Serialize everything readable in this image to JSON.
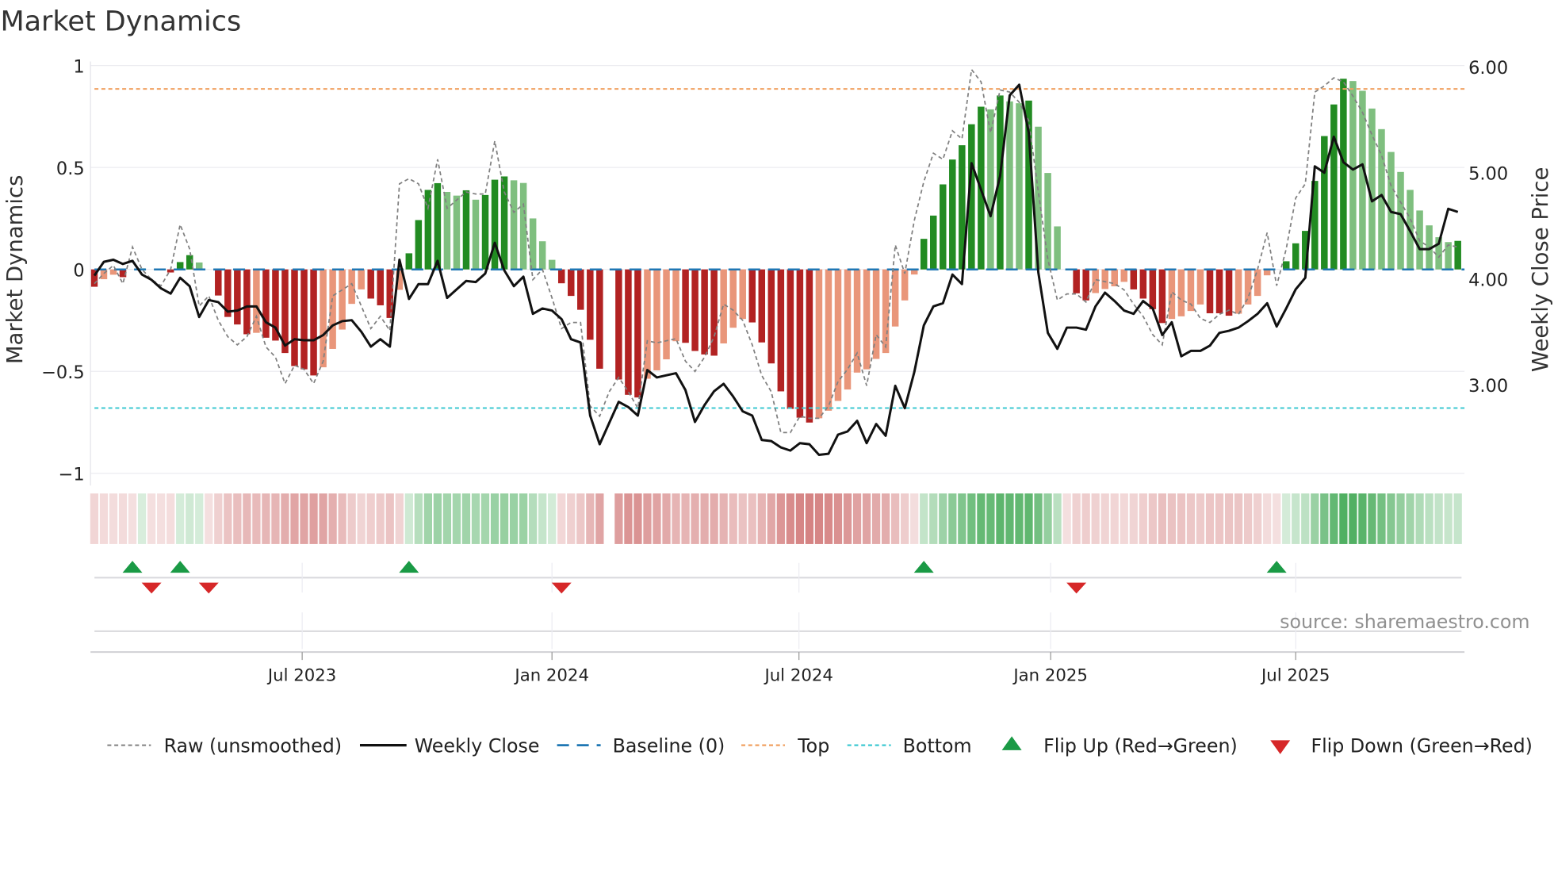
{
  "title": "Market Dynamics",
  "source": "source: sharemaestro.com",
  "colors": {
    "bar_up_strong": "#228b22",
    "bar_up_weak": "#7fbf7f",
    "bar_down_strong": "#b22222",
    "bar_down_weak": "#e9967a",
    "raw": "#808080",
    "close": "#111111",
    "baseline": "#1f77b4",
    "top": "#f0a060",
    "bottom": "#3cc8d2",
    "flip_up": "#1a9a45",
    "flip_down": "#d62728"
  },
  "legend": {
    "raw": "Raw (unsmoothed)",
    "close": "Weekly Close",
    "baseline": "Baseline (0)",
    "top": "Top",
    "bottom": "Bottom",
    "flip_up": "Flip Up (Red→Green)",
    "flip_down": "Flip Down (Green→Red)"
  },
  "chart_data": {
    "type": "bar",
    "title": "Market Dynamics",
    "ylabel": "Market Dynamics",
    "y2label": "Weekly Close Price",
    "x_unit": "week index",
    "xlim": [
      -0.4,
      143.7
    ],
    "ylim": [
      -1.06,
      1.02
    ],
    "y2lim": [
      2.05,
      6.05
    ],
    "y_ticks": [
      {
        "v": 1,
        "label": "1"
      },
      {
        "v": 0.5,
        "label": "0.5"
      },
      {
        "v": 0,
        "label": "0"
      },
      {
        "v": -0.5,
        "label": "−0.5"
      },
      {
        "v": -1,
        "label": "−1"
      }
    ],
    "y2_ticks": [
      {
        "v": 6,
        "label": "6.00"
      },
      {
        "v": 5,
        "label": "5.00"
      },
      {
        "v": 4,
        "label": "4.00"
      },
      {
        "v": 3,
        "label": "3.00"
      }
    ],
    "x_ticks": [
      {
        "v": 21.8,
        "label": "Jul 2023"
      },
      {
        "v": 48.0,
        "label": "Jan 2024"
      },
      {
        "v": 73.9,
        "label": "Jul 2024"
      },
      {
        "v": 100.3,
        "label": "Jan 2025"
      },
      {
        "v": 126.0,
        "label": "Jul 2025"
      }
    ],
    "top_level": 0.885,
    "bottom_level": -0.68,
    "baseline": 0,
    "dynamics": [
      -0.085,
      -0.048,
      -0.026,
      -0.038,
      0,
      0.005,
      0,
      0,
      -0.015,
      0.036,
      0.07,
      0.034,
      0,
      -0.128,
      -0.233,
      -0.27,
      -0.318,
      -0.311,
      -0.335,
      -0.349,
      -0.41,
      -0.474,
      -0.49,
      -0.52,
      -0.48,
      -0.39,
      -0.295,
      -0.169,
      -0.098,
      -0.143,
      -0.176,
      -0.238,
      -0.1,
      0.079,
      0.242,
      0.39,
      0.423,
      0.38,
      0.362,
      0.388,
      0.342,
      0.365,
      0.44,
      0.456,
      0.437,
      0.424,
      0.25,
      0.138,
      0.047,
      -0.068,
      -0.13,
      -0.198,
      -0.345,
      -0.487,
      null,
      -0.54,
      -0.615,
      -0.628,
      -0.536,
      -0.495,
      -0.441,
      -0.352,
      -0.36,
      -0.4,
      -0.417,
      -0.423,
      -0.363,
      -0.286,
      -0.243,
      -0.26,
      -0.358,
      -0.461,
      -0.598,
      -0.684,
      -0.727,
      -0.751,
      -0.73,
      -0.693,
      -0.645,
      -0.589,
      -0.506,
      -0.49,
      -0.439,
      -0.41,
      -0.28,
      -0.152,
      -0.025,
      0.15,
      0.264,
      0.417,
      0.539,
      0.609,
      0.712,
      0.798,
      0.785,
      0.853,
      0.824,
      0.815,
      0.828,
      0.7,
      0.473,
      0.211,
      0,
      -0.117,
      -0.152,
      -0.116,
      -0.096,
      -0.083,
      -0.061,
      -0.098,
      -0.143,
      -0.195,
      -0.263,
      -0.243,
      -0.23,
      -0.204,
      -0.172,
      -0.215,
      -0.215,
      -0.227,
      -0.217,
      -0.172,
      -0.13,
      -0.029,
      0,
      0.04,
      0.128,
      0.189,
      0.434,
      0.654,
      0.809,
      0.935,
      0.924,
      0.876,
      0.789,
      0.688,
      0.576,
      0.478,
      0.39,
      0.289,
      0.216,
      0.158,
      0.134,
      0.14
    ],
    "strong": [
      1,
      0,
      0,
      1,
      0,
      1,
      0,
      0,
      1,
      1,
      1,
      0,
      0,
      1,
      1,
      1,
      1,
      0,
      1,
      1,
      1,
      1,
      1,
      1,
      0,
      0,
      0,
      0,
      0,
      1,
      1,
      1,
      0,
      1,
      1,
      1,
      1,
      0,
      0,
      1,
      0,
      1,
      1,
      1,
      0,
      0,
      0,
      0,
      0,
      1,
      1,
      1,
      1,
      1,
      0,
      1,
      1,
      1,
      0,
      0,
      0,
      0,
      1,
      1,
      1,
      1,
      0,
      0,
      0,
      1,
      1,
      1,
      1,
      1,
      1,
      1,
      0,
      0,
      0,
      0,
      0,
      0,
      0,
      0,
      0,
      0,
      0,
      1,
      1,
      1,
      1,
      1,
      1,
      1,
      0,
      1,
      0,
      0,
      1,
      0,
      0,
      0,
      0,
      1,
      1,
      0,
      0,
      0,
      0,
      1,
      1,
      1,
      1,
      0,
      0,
      0,
      0,
      1,
      1,
      1,
      0,
      0,
      0,
      0,
      0,
      1,
      1,
      1,
      1,
      1,
      1,
      1,
      0,
      0,
      0,
      0,
      0,
      0,
      0,
      0,
      0,
      0,
      0,
      1
    ],
    "raw": [
      -0.07,
      -0.02,
      0.02,
      -0.07,
      0.11,
      0.0,
      -0.05,
      -0.08,
      0.0,
      0.22,
      0.1,
      -0.18,
      -0.13,
      -0.25,
      -0.33,
      -0.37,
      -0.33,
      -0.23,
      -0.38,
      -0.43,
      -0.56,
      -0.47,
      -0.49,
      -0.56,
      -0.45,
      -0.13,
      -0.1,
      -0.07,
      -0.18,
      -0.29,
      -0.23,
      -0.3,
      0.42,
      0.445,
      0.42,
      0.3,
      0.54,
      0.3,
      0.34,
      0.38,
      0.37,
      0.37,
      0.63,
      0.38,
      0.28,
      0.32,
      -0.05,
      0.0,
      -0.14,
      -0.29,
      -0.26,
      -0.26,
      -0.67,
      -0.72,
      -0.6,
      -0.53,
      -0.6,
      -0.68,
      -0.35,
      -0.36,
      -0.35,
      -0.34,
      -0.45,
      -0.5,
      -0.43,
      -0.33,
      -0.17,
      -0.2,
      -0.25,
      -0.37,
      -0.52,
      -0.6,
      -0.8,
      -0.8,
      -0.72,
      -0.73,
      -0.73,
      -0.67,
      -0.55,
      -0.49,
      -0.41,
      -0.57,
      -0.32,
      -0.38,
      0.12,
      -0.02,
      0.24,
      0.43,
      0.57,
      0.54,
      0.68,
      0.64,
      0.98,
      0.92,
      0.67,
      0.88,
      0.87,
      0.82,
      0.73,
      0.38,
      0.05,
      -0.15,
      -0.12,
      -0.12,
      -0.16,
      -0.05,
      -0.06,
      -0.07,
      -0.1,
      -0.17,
      -0.23,
      -0.32,
      -0.37,
      -0.11,
      -0.15,
      -0.17,
      -0.24,
      -0.26,
      -0.22,
      -0.2,
      -0.22,
      -0.14,
      0.0,
      0.18,
      -0.08,
      0.1,
      0.35,
      0.42,
      0.87,
      0.9,
      0.94,
      0.92,
      0.85,
      0.77,
      0.66,
      0.56,
      0.41,
      0.33,
      0.25,
      0.14,
      0.11,
      0.06,
      0.12,
      0.11
    ],
    "close": [
      4.03,
      4.16,
      4.18,
      4.14,
      4.17,
      4.04,
      3.99,
      3.91,
      3.86,
      4.01,
      3.93,
      3.64,
      3.8,
      3.78,
      3.69,
      3.7,
      3.74,
      3.74,
      3.59,
      3.54,
      3.37,
      3.43,
      3.42,
      3.42,
      3.47,
      3.56,
      3.6,
      3.61,
      3.5,
      3.36,
      3.43,
      3.36,
      4.18,
      3.81,
      3.95,
      3.95,
      4.17,
      3.82,
      3.9,
      3.98,
      3.97,
      4.05,
      4.34,
      4.08,
      3.93,
      4.02,
      3.67,
      3.72,
      3.7,
      3.62,
      3.43,
      3.4,
      2.71,
      2.44,
      2.64,
      2.84,
      2.79,
      2.71,
      3.14,
      3.07,
      3.09,
      3.11,
      2.95,
      2.65,
      2.81,
      2.94,
      3.01,
      2.89,
      2.75,
      2.71,
      2.48,
      2.47,
      2.41,
      2.38,
      2.45,
      2.44,
      2.34,
      2.35,
      2.53,
      2.56,
      2.66,
      2.45,
      2.63,
      2.52,
      2.99,
      2.78,
      3.12,
      3.56,
      3.74,
      3.77,
      4.04,
      3.95,
      5.09,
      4.84,
      4.59,
      4.97,
      5.73,
      5.83,
      5.38,
      4.06,
      3.49,
      3.34,
      3.54,
      3.54,
      3.52,
      3.74,
      3.87,
      3.79,
      3.7,
      3.67,
      3.79,
      3.72,
      3.47,
      3.59,
      3.27,
      3.32,
      3.32,
      3.37,
      3.49,
      3.51,
      3.54,
      3.6,
      3.67,
      3.77,
      3.55,
      3.72,
      3.9,
      4.01,
      5.06,
      5.0,
      5.34,
      5.1,
      5.03,
      5.08,
      4.73,
      4.79,
      4.63,
      4.61,
      4.45,
      4.28,
      4.28,
      4.33,
      4.66,
      4.63
    ],
    "flip_up_weeks": [
      4,
      9,
      33,
      87,
      124
    ],
    "flip_down_weeks": [
      6,
      12,
      49,
      103
    ],
    "grid": true,
    "legend_position": "bottom"
  }
}
